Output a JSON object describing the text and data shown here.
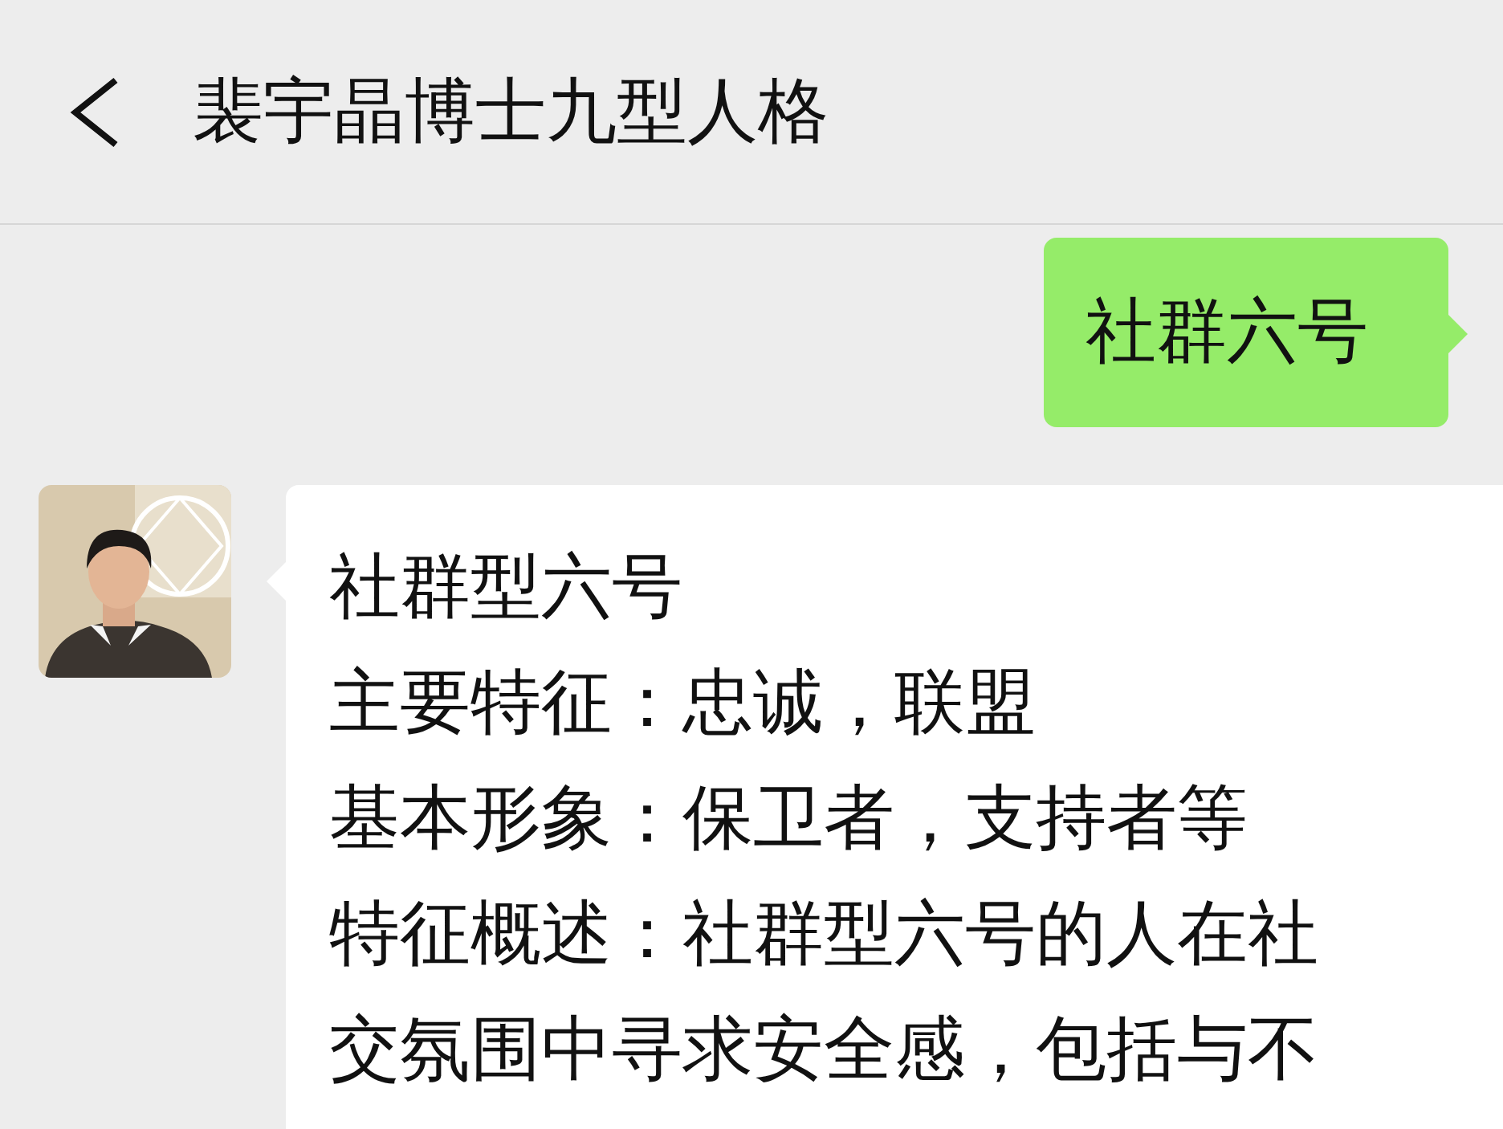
{
  "header": {
    "title": "裴宇晶博士九型人格"
  },
  "messages": [
    {
      "kind": "sent",
      "lines": [
        "社群六号"
      ]
    },
    {
      "kind": "received",
      "lines": [
        "社群型六号",
        "主要特征：忠诚，联盟",
        "基本形象：保卫者，支持者等",
        "特征概述：社群型六号的人在社",
        "交氛围中寻求安全感，包括与不"
      ]
    }
  ]
}
